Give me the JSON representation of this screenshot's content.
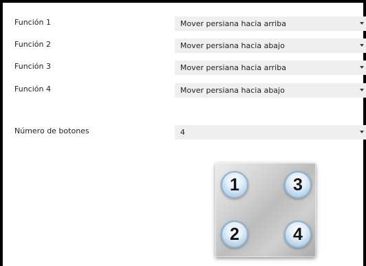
{
  "rows": [
    {
      "label": "Función 1",
      "value": "Mover persiana hacia arriba"
    },
    {
      "label": "Función 2",
      "value": "Mover persiana hacia abajo"
    },
    {
      "label": "Función 3",
      "value": "Mover persiana hacia arriba"
    },
    {
      "label": "Función 4",
      "value": "Mover persiana hacia abajo"
    }
  ],
  "buttons_count": {
    "label": "Número de botones",
    "value": "4"
  },
  "keypad": {
    "buttons": [
      "1",
      "3",
      "2",
      "4"
    ]
  },
  "colors": {
    "select_background": "#efefef",
    "keypad_button_border": "#8fb3cf",
    "frame_border": "#000000"
  },
  "icons": {
    "dropdown": "chevron-down-icon"
  }
}
